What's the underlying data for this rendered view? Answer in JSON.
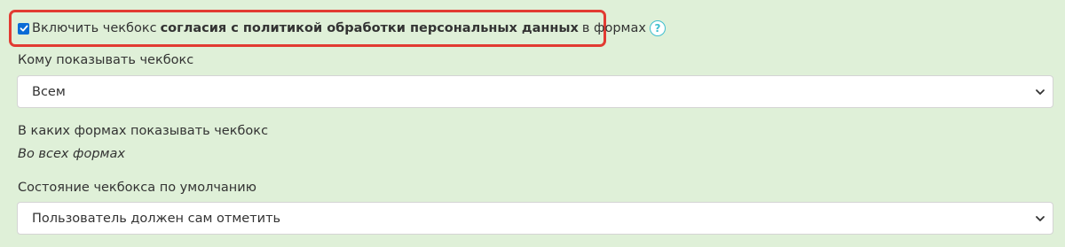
{
  "consent": {
    "checked": true,
    "prefix": "Включить чекбокс",
    "bold": "согласия с политикой обработки персональных данных",
    "suffix": "в формах",
    "help_glyph": "?"
  },
  "who": {
    "label": "Кому показывать чекбокс",
    "selected": "Всем"
  },
  "forms": {
    "label": "В каких формах показывать чекбокс",
    "value": "Во всех формах"
  },
  "default_state": {
    "label": "Состояние чекбокса по умолчанию",
    "selected": "Пользователь должен сам отметить"
  },
  "colors": {
    "background": "#dff0d8",
    "highlight": "#e23b32",
    "checkbox": "#0a6cd6",
    "help_icon": "#3fbfcf"
  },
  "icons": {
    "checkbox": "checkmark-icon",
    "help": "question-circle-icon",
    "select": "chevron-down-icon"
  }
}
